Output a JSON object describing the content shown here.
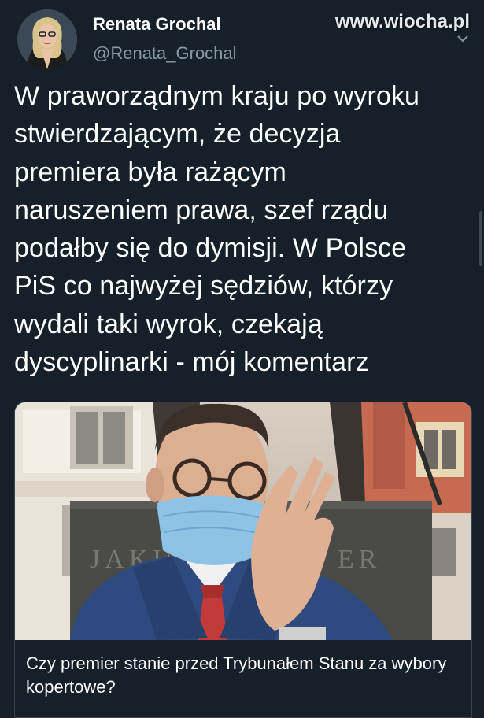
{
  "watermark": "www.wiocha.pl",
  "author": {
    "display_name": "Renata Grochal",
    "handle": "@Renata_Grochal",
    "avatar_icon": "profile-photo"
  },
  "tweet": {
    "text": "W praworządnym kraju po wyroku\nstwierdzającym, że decyzja\npremiera była rażącym\nnaruszeniem prawa, szef rządu\npodałby się do dymisji. W Polsce\nPiS co najwyżej sędziów, którzy\nwydali taki wyrok, czekają\ndyscyplinarki - mój komentarz"
  },
  "card": {
    "title": "Czy premier stanie przed Trybunałem Stanu za wybory kopertowe?",
    "image_icon": "man-in-face-mask-photo",
    "monument_text": "JAKUB                ER"
  },
  "colors": {
    "background": "#15202b",
    "text": "#ffffff",
    "secondary_text": "#8899a6",
    "card_border": "#38444d",
    "mask": "#8ec3e6"
  }
}
